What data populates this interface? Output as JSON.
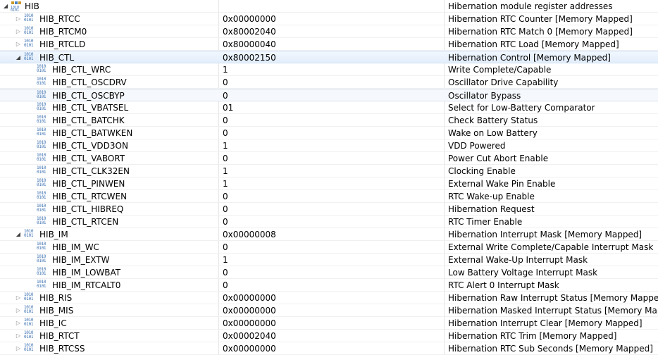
{
  "peripheral": {
    "name": "HIB",
    "description": "Hibernation module register addresses"
  },
  "rows": [
    {
      "name": "HIB_RTCC",
      "value": "0x00000000",
      "description": "Hibernation RTC Counter [Memory Mapped]"
    },
    {
      "name": "HIB_RTCM0",
      "value": "0x80002040",
      "description": "Hibernation RTC Match 0 [Memory Mapped]"
    },
    {
      "name": "HIB_RTCLD",
      "value": "0x80000040",
      "description": "Hibernation RTC Load [Memory Mapped]"
    },
    {
      "name": "HIB_CTL",
      "value": "0x80002150",
      "description": "Hibernation Control [Memory Mapped]"
    },
    {
      "name": "HIB_CTL_WRC",
      "value": "1",
      "description": "Write Complete/Capable"
    },
    {
      "name": "HIB_CTL_OSCDRV",
      "value": "0",
      "description": "Oscillator Drive Capability"
    },
    {
      "name": "HIB_CTL_OSCBYP",
      "value": "0",
      "description": "Oscillator Bypass"
    },
    {
      "name": "HIB_CTL_VBATSEL",
      "value": "01",
      "description": "Select for Low-Battery Comparator"
    },
    {
      "name": "HIB_CTL_BATCHK",
      "value": "0",
      "description": "Check Battery Status"
    },
    {
      "name": "HIB_CTL_BATWKEN",
      "value": "0",
      "description": "Wake on Low Battery"
    },
    {
      "name": "HIB_CTL_VDD3ON",
      "value": "1",
      "description": "VDD Powered"
    },
    {
      "name": "HIB_CTL_VABORT",
      "value": "0",
      "description": "Power Cut Abort Enable"
    },
    {
      "name": "HIB_CTL_CLK32EN",
      "value": "1",
      "description": "Clocking Enable"
    },
    {
      "name": "HIB_CTL_PINWEN",
      "value": "1",
      "description": "External Wake Pin Enable"
    },
    {
      "name": "HIB_CTL_RTCWEN",
      "value": "0",
      "description": "RTC Wake-up Enable"
    },
    {
      "name": "HIB_CTL_HIBREQ",
      "value": "0",
      "description": "Hibernation Request"
    },
    {
      "name": "HIB_CTL_RTCEN",
      "value": "0",
      "description": "RTC Timer Enable"
    },
    {
      "name": "HIB_IM",
      "value": "0x00000008",
      "description": "Hibernation Interrupt Mask [Memory Mapped]"
    },
    {
      "name": "HIB_IM_WC",
      "value": "0",
      "description": "External Write Complete/Capable Interrupt Mask"
    },
    {
      "name": "HIB_IM_EXTW",
      "value": "1",
      "description": "External Wake-Up Interrupt Mask"
    },
    {
      "name": "HIB_IM_LOWBAT",
      "value": "0",
      "description": "Low Battery Voltage Interrupt Mask"
    },
    {
      "name": "HIB_IM_RTCALT0",
      "value": "0",
      "description": "RTC Alert 0 Interrupt Mask"
    },
    {
      "name": "HIB_RIS",
      "value": "0x00000000",
      "description": "Hibernation Raw Interrupt Status [Memory Mapped]"
    },
    {
      "name": "HIB_MIS",
      "value": "0x00000000",
      "description": "Hibernation Masked Interrupt Status [Memory Mapped]"
    },
    {
      "name": "HIB_IC",
      "value": "0x00000000",
      "description": "Hibernation Interrupt Clear [Memory Mapped]"
    },
    {
      "name": "HIB_RTCT",
      "value": "0x00002040",
      "description": "Hibernation RTC Trim [Memory Mapped]"
    },
    {
      "name": "HIB_RTCSS",
      "value": "0x00000000",
      "description": "Hibernation RTC Sub Seconds [Memory Mapped]"
    }
  ],
  "icons": {
    "peripheral": "peripheral-icon",
    "register": "register-binary-icon",
    "expanded": "triangle-down-icon",
    "collapsed": "triangle-right-icon"
  },
  "register_icon_text": {
    "line1": "1010",
    "line2": "0101"
  },
  "colors": {
    "selected_row": "#e3eefb",
    "register_icon": "#3a6fb0",
    "grid": "#e4e4e4"
  }
}
